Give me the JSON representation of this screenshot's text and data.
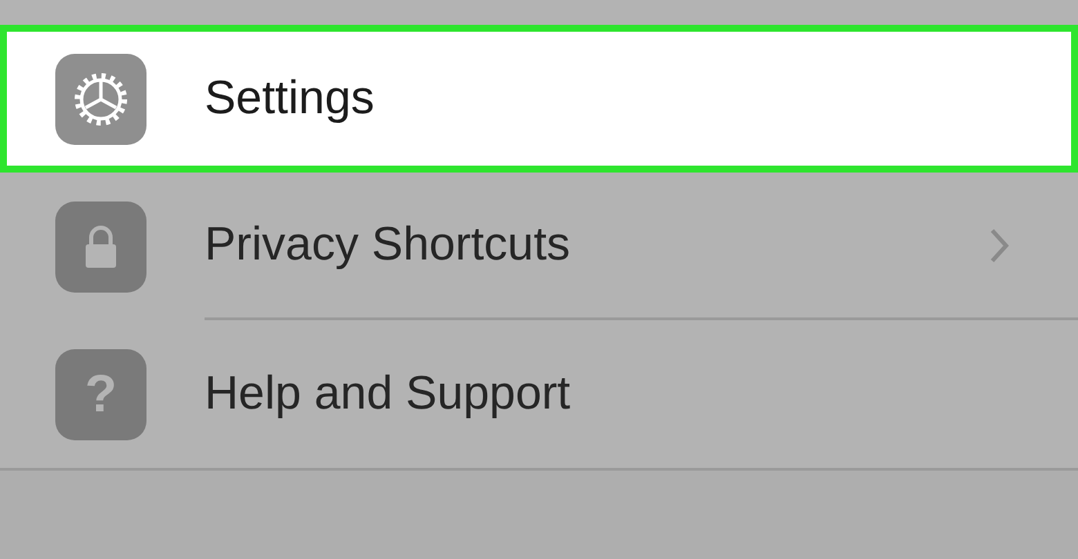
{
  "menu": {
    "items": [
      {
        "kind": "gear",
        "label": "Settings",
        "selected": true,
        "chevron": false
      },
      {
        "kind": "lock",
        "label": "Privacy Shortcuts",
        "selected": false,
        "chevron": true
      },
      {
        "kind": "glyph",
        "glyph": "?",
        "label": "Help and Support",
        "selected": false,
        "chevron": false
      }
    ]
  }
}
